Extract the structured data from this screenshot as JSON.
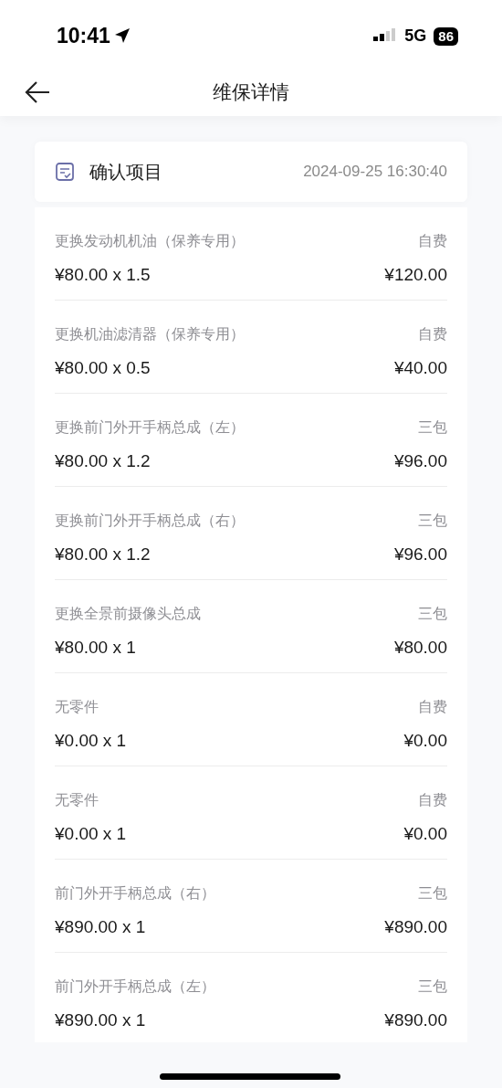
{
  "status_bar": {
    "time": "10:41",
    "network": "5G",
    "battery": "86"
  },
  "header": {
    "title": "维保详情"
  },
  "section": {
    "title": "确认项目",
    "datetime": "2024-09-25 16:30:40"
  },
  "items": [
    {
      "name": "更换发动机机油（保养专用）",
      "payer": "自费",
      "price": "¥80.00 x 1.5",
      "total": "¥120.00"
    },
    {
      "name": "更换机油滤清器（保养专用）",
      "payer": "自费",
      "price": "¥80.00 x 0.5",
      "total": "¥40.00"
    },
    {
      "name": "更换前门外开手柄总成（左）",
      "payer": "三包",
      "price": "¥80.00 x 1.2",
      "total": "¥96.00"
    },
    {
      "name": "更换前门外开手柄总成（右）",
      "payer": "三包",
      "price": "¥80.00 x 1.2",
      "total": "¥96.00"
    },
    {
      "name": "更换全景前摄像头总成",
      "payer": "三包",
      "price": "¥80.00 x 1",
      "total": "¥80.00"
    },
    {
      "name": "无零件",
      "payer": "自费",
      "price": "¥0.00 x 1",
      "total": "¥0.00"
    },
    {
      "name": "无零件",
      "payer": "自费",
      "price": "¥0.00 x 1",
      "total": "¥0.00"
    },
    {
      "name": "前门外开手柄总成（右）",
      "payer": "三包",
      "price": "¥890.00 x 1",
      "total": "¥890.00"
    },
    {
      "name": "前门外开手柄总成（左）",
      "payer": "三包",
      "price": "¥890.00 x 1",
      "total": "¥890.00"
    }
  ]
}
